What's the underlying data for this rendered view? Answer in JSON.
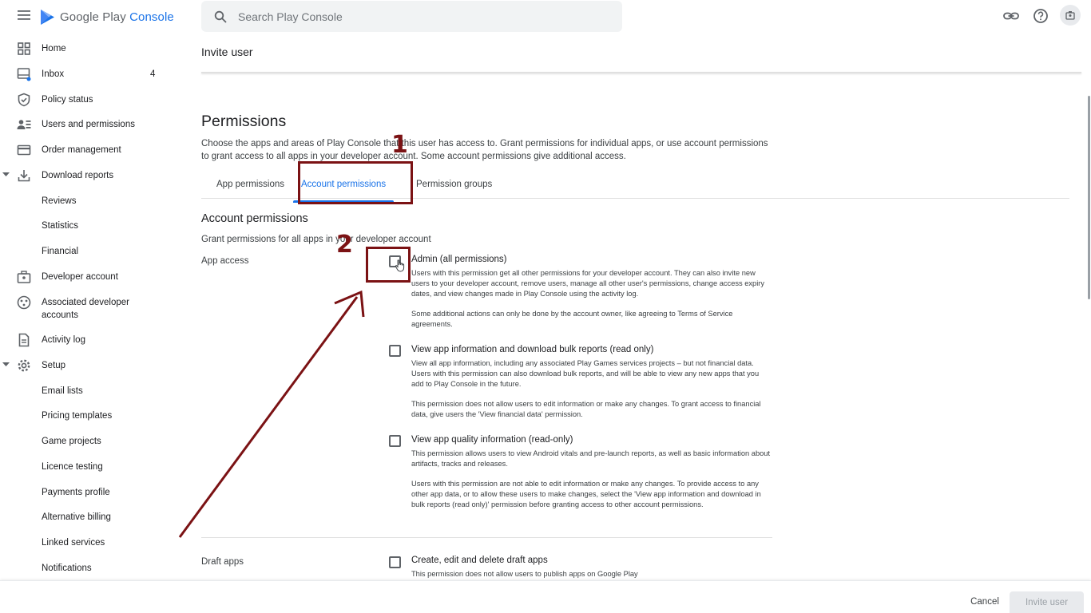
{
  "header": {
    "logo_text_main": "Google Play ",
    "logo_text_accent": "Console",
    "search_placeholder": "Search Play Console",
    "icons": [
      "menu-icon",
      "play-console-logo",
      "search-icon",
      "link-icon",
      "help-icon",
      "account-icon"
    ]
  },
  "sidebar": {
    "items": [
      {
        "label": "Home",
        "icon": "home-icon"
      },
      {
        "label": "Inbox",
        "icon": "inbox-icon",
        "count": "4"
      },
      {
        "label": "Policy status",
        "icon": "shield-icon"
      },
      {
        "label": "Users and permissions",
        "icon": "users-icon"
      },
      {
        "label": "Order management",
        "icon": "credit-card-icon"
      },
      {
        "label": "Download reports",
        "icon": "download-icon"
      },
      {
        "label": "Reviews"
      },
      {
        "label": "Statistics"
      },
      {
        "label": "Financial"
      },
      {
        "label": "Developer account",
        "icon": "briefcase-icon"
      },
      {
        "label": "Associated developer",
        "label2": "accounts",
        "icon": "linked-accounts-icon"
      },
      {
        "label": "Activity log",
        "icon": "document-icon"
      },
      {
        "label": "Setup",
        "icon": "gear-icon"
      },
      {
        "label": "Email lists"
      },
      {
        "label": "Pricing templates"
      },
      {
        "label": "Game projects"
      },
      {
        "label": "Licence testing"
      },
      {
        "label": "Payments profile"
      },
      {
        "label": "Alternative billing"
      },
      {
        "label": "Linked services"
      },
      {
        "label": "Notifications"
      }
    ]
  },
  "main": {
    "page_title": "Invite user",
    "heading": "Permissions",
    "description": "Choose the apps and areas of Play Console that this user has access to. Grant permissions for individual apps, or use account permissions to grant access to all apps in your developer account. Some account permissions give additional access.",
    "tabs": [
      "App permissions",
      "Account permissions",
      "Permission groups"
    ],
    "active_tab": "Account permissions",
    "section_title": "Account permissions",
    "section_sub": "Grant permissions for all apps in your developer account",
    "app_access_label": "App access",
    "draft_apps_label": "Draft apps",
    "permissions": [
      {
        "title": "Admin (all permissions)",
        "desc": "Users with this permission get all other permissions for your developer account. They can also invite new users to your developer account, remove users, manage all other user's permissions, change access expiry dates, and view changes made in Play Console using the activity log.",
        "desc2": "Some additional actions can only be done by the account owner, like agreeing to Terms of Service agreements."
      },
      {
        "title": "View app information and download bulk reports (read only)",
        "desc": "View all app information, including any associated Play Games services projects – but not financial data. Users with this permission can also download bulk reports, and will be able to view any new apps that you add to Play Console in the future.",
        "desc2": "This permission does not allow users to edit information or make any changes. To grant access to financial data, give users the 'View financial data' permission."
      },
      {
        "title": "View app quality information (read-only)",
        "desc": "This permission allows users to view Android vitals and pre-launch reports, as well as basic information about artifacts, tracks and releases.",
        "desc2": "Users with this permission are not able to edit information or make any changes. To provide access to any other app data, or to allow these users to make changes, select the 'View app information and download in bulk reports (read only)' permission before granting access to other account permissions."
      },
      {
        "title": "Create, edit and delete draft apps",
        "desc": "This permission does not allow users to publish apps on Google Play"
      }
    ]
  },
  "footer": {
    "cancel_label": "Cancel",
    "invite_label": "Invite user"
  },
  "annotations": {
    "step1": "1",
    "step2": "2",
    "color": "#7b1214"
  },
  "colors": {
    "accent": "#1a73e8",
    "annotation": "#7b1214"
  }
}
